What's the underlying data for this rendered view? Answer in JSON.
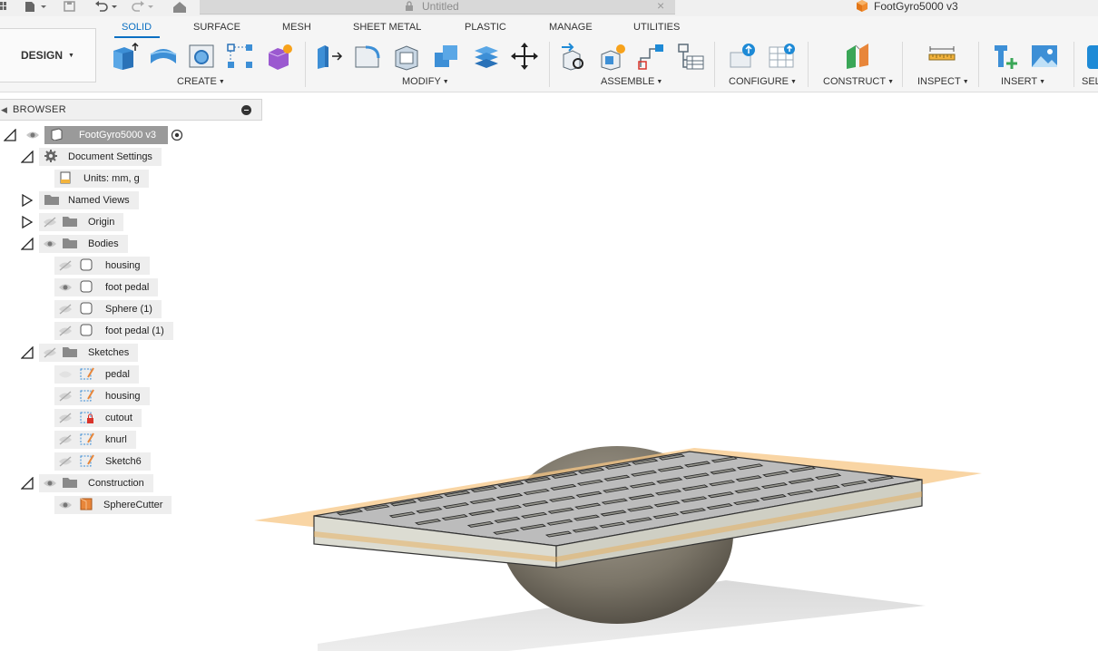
{
  "window": {
    "tab_title": "Untitled",
    "document_title": "FootGyro5000 v3"
  },
  "toolbar": {
    "workspace_label": "DESIGN",
    "tabs": [
      {
        "label": "SOLID",
        "active": true
      },
      {
        "label": "SURFACE",
        "active": false
      },
      {
        "label": "MESH",
        "active": false
      },
      {
        "label": "SHEET METAL",
        "active": false
      },
      {
        "label": "PLASTIC",
        "active": false
      },
      {
        "label": "MANAGE",
        "active": false
      },
      {
        "label": "UTILITIES",
        "active": false
      }
    ],
    "groups": [
      {
        "label": "CREATE"
      },
      {
        "label": "MODIFY"
      },
      {
        "label": "ASSEMBLE"
      },
      {
        "label": "CONFIGURE"
      },
      {
        "label": "CONSTRUCT"
      },
      {
        "label": "INSPECT"
      },
      {
        "label": "INSERT"
      },
      {
        "label": "SEL"
      }
    ],
    "accent_color": "#0a6fc2"
  },
  "browser": {
    "title": "BROWSER",
    "root": {
      "label": "FootGyro5000 v3"
    },
    "document_settings": {
      "label": "Document Settings",
      "units": "Units: mm, g"
    },
    "named_views": {
      "label": "Named Views"
    },
    "origin": {
      "label": "Origin"
    },
    "bodies": {
      "label": "Bodies",
      "items": [
        {
          "label": "housing",
          "visible": false
        },
        {
          "label": "foot pedal",
          "visible": true
        },
        {
          "label": "Sphere (1)",
          "visible": false
        },
        {
          "label": "foot pedal (1)",
          "visible": false
        }
      ]
    },
    "sketches": {
      "label": "Sketches",
      "items": [
        {
          "label": "pedal",
          "visible": false
        },
        {
          "label": "housing",
          "visible": false
        },
        {
          "label": "cutout",
          "visible": false
        },
        {
          "label": "knurl",
          "visible": false
        },
        {
          "label": "Sketch6",
          "visible": false
        }
      ]
    },
    "construction": {
      "label": "Construction",
      "items": [
        {
          "label": "SphereCutter",
          "visible": true
        }
      ]
    }
  }
}
